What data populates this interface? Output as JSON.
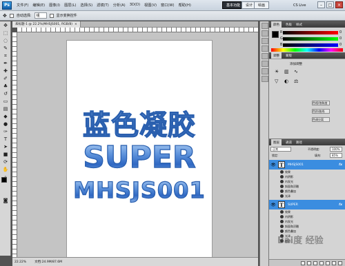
{
  "app": {
    "logo": "Ps",
    "menu": [
      "文件(F)",
      "编辑(E)",
      "图像(I)",
      "图层(L)",
      "选择(S)",
      "滤镜(T)",
      "分析(A)",
      "3D(D)",
      "视图(V)",
      "窗口(W)",
      "帮助(H)"
    ],
    "zoom_button": "33.3",
    "workspace": [
      "基本功能",
      "设计",
      "绘画"
    ],
    "cslive": "CS Live"
  },
  "options": {
    "auto_select": "自动选择:",
    "auto_select_value": "组",
    "show_transform": "显示变换控件"
  },
  "document": {
    "tab": "未标题-1 @ 22.2%(MHSJS001, RGB/8)",
    "close": "×",
    "zoom": "22.22%",
    "doc_info": "文档:24.9M/87.6M"
  },
  "artwork": {
    "line1": "蓝色凝胶",
    "line2": "SUPER",
    "line3": "MHSJS001"
  },
  "panels": {
    "color_tabs": [
      "颜色",
      "色板",
      "样式"
    ],
    "color_labels": [
      "R",
      "G",
      "B"
    ],
    "color_values": [
      "0",
      "0",
      "0"
    ],
    "adj_tabs": [
      "调整",
      "蒙版"
    ],
    "adj_title": "添加调整",
    "adj_buttons": [
      "色相/饱和度",
      "色阶/曲线",
      "色调分离"
    ],
    "layers_tabs": [
      "图层",
      "通道",
      "路径"
    ],
    "blend_mode": "正常",
    "opacity_label": "不透明度:",
    "opacity": "100%",
    "lock_label": "锁定:",
    "fill_label": "填充:",
    "fill": "85%",
    "layers": [
      {
        "name": "MHSJS001",
        "effects": [
          "效果",
          "内阴影",
          "内发光",
          "斜面和浮雕",
          "颜色叠加",
          "光泽"
        ]
      },
      {
        "name": "SUPER",
        "effects": [
          "效果",
          "内阴影",
          "内发光",
          "斜面和浮雕",
          "颜色叠加",
          "光泽",
          "描边"
        ]
      }
    ],
    "fx": "fx"
  },
  "watermark": "Bai度 经验"
}
